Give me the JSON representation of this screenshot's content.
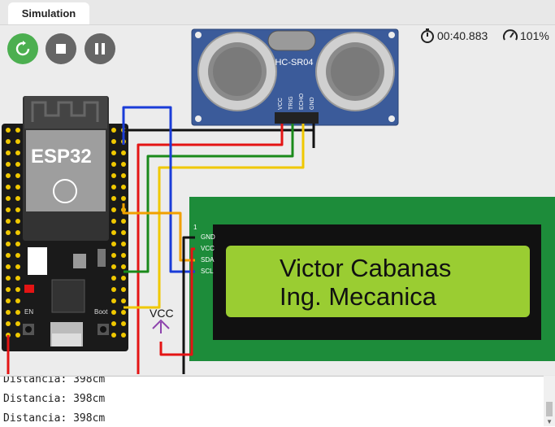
{
  "tab": {
    "label": "Simulation"
  },
  "controls": {
    "restart_icon": "restart-icon",
    "stop_icon": "stop-icon",
    "pause_icon": "pause-icon"
  },
  "status": {
    "elapsed": "00:40.883",
    "speed": "101%"
  },
  "board": {
    "label": "ESP32",
    "en_label": "EN",
    "boot_label": "Boot"
  },
  "sensor": {
    "label": "HC-SR04",
    "pins": [
      "VCC",
      "TRIG",
      "ECHO",
      "GND"
    ]
  },
  "lcd": {
    "line1": "Victor Cabanas",
    "line2": "Ing. Mecanica",
    "pin_index": "1",
    "pins": [
      "GND",
      "VCC",
      "SDA",
      "SCL"
    ]
  },
  "annotation": {
    "vcc_label": "VCC"
  },
  "console": {
    "lines": [
      "Distancia: 398cm",
      "Distancia: 398cm",
      "Distancia: 398cm"
    ]
  },
  "colors": {
    "wire_red": "#e41414",
    "wire_black": "#111111",
    "wire_green": "#1a8a1a",
    "wire_yellow": "#f0c800",
    "wire_blue": "#1a3cd8",
    "wire_orange": "#f0a000",
    "lcd_screen": "#9acd32",
    "pcb_green": "#1d8c3a",
    "sensor_blue": "#3b5b9a"
  }
}
